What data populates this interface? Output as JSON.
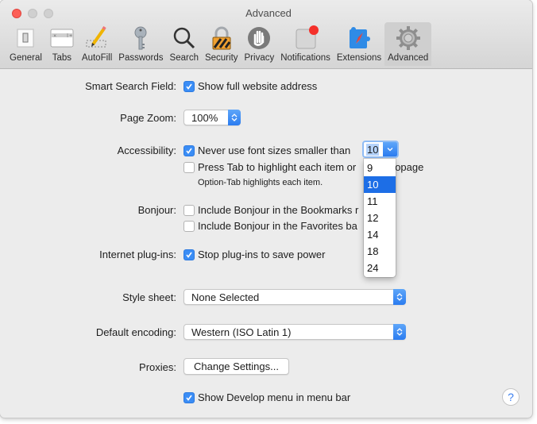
{
  "window": {
    "title": "Advanced"
  },
  "toolbar": {
    "items": [
      {
        "label": "General",
        "icon": "general-switch-icon"
      },
      {
        "label": "Tabs",
        "icon": "tabs-icon"
      },
      {
        "label": "AutoFill",
        "icon": "pencil-icon"
      },
      {
        "label": "Passwords",
        "icon": "key-icon"
      },
      {
        "label": "Search",
        "icon": "magnifier-icon"
      },
      {
        "label": "Security",
        "icon": "lock-icon"
      },
      {
        "label": "Privacy",
        "icon": "hand-icon"
      },
      {
        "label": "Notifications",
        "icon": "notifications-icon"
      },
      {
        "label": "Extensions",
        "icon": "puzzle-compass-icon"
      },
      {
        "label": "Advanced",
        "icon": "gear-icon",
        "active": true
      }
    ]
  },
  "settings": {
    "smart_search": {
      "label": "Smart Search Field:",
      "option": "Show full website address",
      "checked": true
    },
    "page_zoom": {
      "label": "Page Zoom:",
      "value": "100%"
    },
    "accessibility": {
      "label": "Accessibility:",
      "option1": "Never use font sizes smaller than",
      "option1_checked": true,
      "font_size_value": "10",
      "option2": "Press Tab to highlight each item on a webpage",
      "option2_visible": "Press Tab to highlight each item or",
      "option2_tail": "opage",
      "option2_checked": false,
      "note": "Option-Tab highlights each item."
    },
    "bonjour": {
      "label": "Bonjour:",
      "option1": "Include Bonjour in the Bookmarks r",
      "option1_checked": false,
      "option2": "Include Bonjour in the Favorites ba",
      "option2_checked": false
    },
    "plugins": {
      "label": "Internet plug-ins:",
      "option": "Stop plug-ins to save power",
      "checked": true
    },
    "style_sheet": {
      "label": "Style sheet:",
      "value": "None Selected"
    },
    "encoding": {
      "label": "Default encoding:",
      "value": "Western (ISO Latin 1)"
    },
    "proxies": {
      "label": "Proxies:",
      "button": "Change Settings..."
    },
    "develop": {
      "option": "Show Develop menu in menu bar",
      "checked": true
    }
  },
  "font_size_menu": {
    "options": [
      "9",
      "10",
      "11",
      "12",
      "14",
      "18",
      "24"
    ],
    "selected": "10"
  },
  "help": {
    "label": "?"
  },
  "colors": {
    "accent": "#3b8df5",
    "menu_selection": "#1d6ee6"
  }
}
